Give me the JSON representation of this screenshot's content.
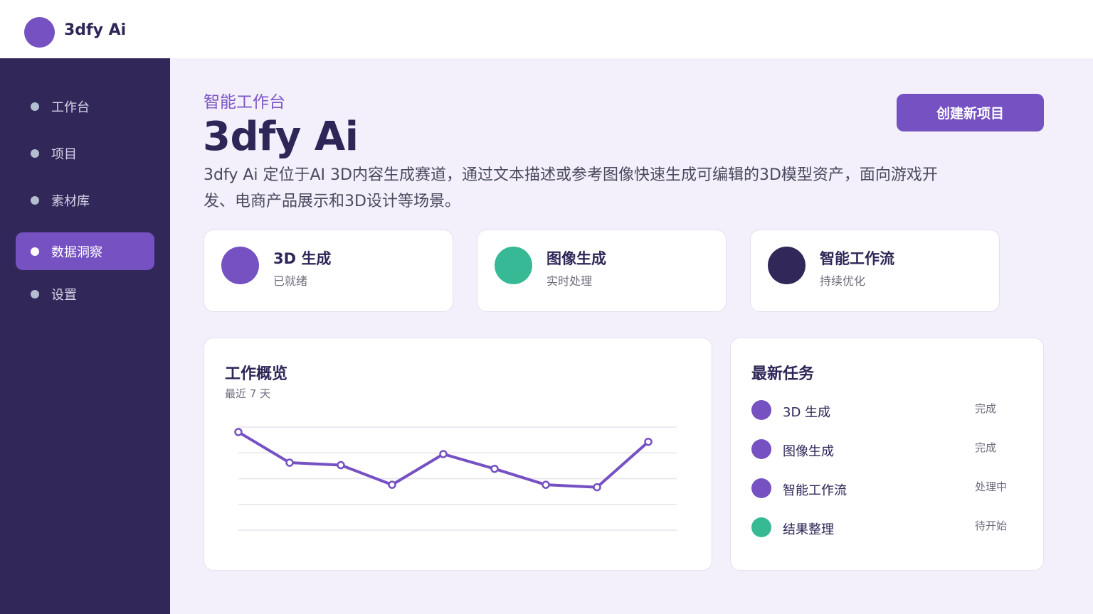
{
  "app": {
    "name": "3dfy Ai",
    "brand_color": "#7551c2"
  },
  "sidebar": {
    "items": [
      {
        "label": "工作台",
        "active": false
      },
      {
        "label": "项目",
        "active": false
      },
      {
        "label": "素材库",
        "active": false
      },
      {
        "label": "数据洞察",
        "active": true
      },
      {
        "label": "设置",
        "active": false
      }
    ]
  },
  "header": {
    "eyebrow": "智能工作台",
    "title": "3dfy Ai",
    "description": "3dfy Ai 定位于AI 3D内容生成赛道，通过文本描述或参考图像快速生成可编辑的3D模型资产，面向游戏开发、电商产品展示和3D设计等场景。",
    "create_button": "创建新项目"
  },
  "stats": [
    {
      "title": "3D 生成",
      "sub": "已就绪",
      "color": "#7551c2"
    },
    {
      "title": "图像生成",
      "sub": "实时处理",
      "color": "#37b995"
    },
    {
      "title": "智能工作流",
      "sub": "持续优化",
      "color": "#312859"
    }
  ],
  "overview": {
    "title": "工作概览",
    "subtitle": "最近 7 天"
  },
  "chart_data": {
    "type": "line",
    "title": "工作概览",
    "subtitle": "最近 7 天",
    "values": [
      100,
      75,
      73,
      57,
      82,
      70,
      57,
      55,
      92
    ],
    "ylim": [
      20,
      104
    ],
    "grid": true,
    "color": "#7551c2"
  },
  "tasks": {
    "title": "最新任务",
    "items": [
      {
        "name": "3D 生成",
        "status": "完成",
        "color": "#7551c2"
      },
      {
        "name": "图像生成",
        "status": "完成",
        "color": "#7551c2"
      },
      {
        "name": "智能工作流",
        "status": "处理中",
        "color": "#7551c2"
      },
      {
        "name": "结果整理",
        "status": "待开始",
        "color": "#37b995"
      }
    ]
  }
}
